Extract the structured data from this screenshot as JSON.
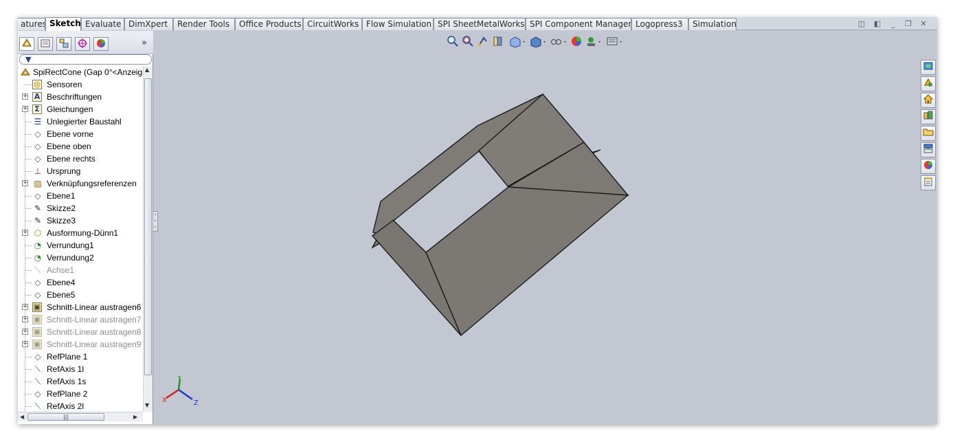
{
  "tabs": [
    {
      "label": "atures",
      "active": false
    },
    {
      "label": "Sketch",
      "active": true
    },
    {
      "label": "Evaluate",
      "active": false
    },
    {
      "label": "DimXpert",
      "active": false
    },
    {
      "label": "Render Tools",
      "active": false
    },
    {
      "label": "Office Products",
      "active": false
    },
    {
      "label": "CircuitWorks",
      "active": false
    },
    {
      "label": "Flow Simulation",
      "active": false
    },
    {
      "label": "SPI SheetMetalWorks",
      "active": false
    },
    {
      "label": "SPI Component Manager",
      "active": false
    },
    {
      "label": "Logopress3",
      "active": false
    },
    {
      "label": "Simulation",
      "active": false
    }
  ],
  "window_controls": {
    "tile_left": "◫",
    "tile_right": "◧",
    "minimize": "_",
    "restore": "❐",
    "close": "✕"
  },
  "panel": {
    "tab_icons": [
      "feature-manager-icon",
      "property-manager-icon",
      "configuration-manager-icon",
      "dimxpert-manager-icon",
      "display-manager-icon"
    ],
    "more": "»",
    "filter_icon": "▼"
  },
  "tree": {
    "root": "SpiRectCone  (Gap 0°<Anzeig",
    "items": [
      {
        "label": "Sensoren",
        "icon": "sensor-icon",
        "glyph": "◎",
        "expandable": false,
        "dim": false
      },
      {
        "label": "Beschriftungen",
        "icon": "annotations-icon",
        "glyph": "A",
        "expandable": true,
        "dim": false
      },
      {
        "label": "Gleichungen",
        "icon": "equations-icon",
        "glyph": "Σ",
        "expandable": true,
        "dim": false
      },
      {
        "label": "Unlegierter Baustahl",
        "icon": "material-icon",
        "glyph": "☰",
        "expandable": false,
        "dim": false
      },
      {
        "label": "Ebene vorne",
        "icon": "plane-icon",
        "glyph": "◇",
        "expandable": false,
        "dim": false
      },
      {
        "label": "Ebene oben",
        "icon": "plane-icon",
        "glyph": "◇",
        "expandable": false,
        "dim": false
      },
      {
        "label": "Ebene rechts",
        "icon": "plane-icon",
        "glyph": "◇",
        "expandable": false,
        "dim": false
      },
      {
        "label": "Ursprung",
        "icon": "origin-icon",
        "glyph": "⊥",
        "expandable": false,
        "dim": false
      },
      {
        "label": "Verknüpfungsreferenzen",
        "icon": "mate-reference-icon",
        "glyph": "▨",
        "expandable": true,
        "dim": false
      },
      {
        "label": "Ebene1",
        "icon": "plane-icon",
        "glyph": "◇",
        "expandable": false,
        "dim": false
      },
      {
        "label": "Skizze2",
        "icon": "sketch-icon",
        "glyph": "✎",
        "expandable": false,
        "dim": false
      },
      {
        "label": "Skizze3",
        "icon": "sketch-icon",
        "glyph": "✎",
        "expandable": false,
        "dim": false
      },
      {
        "label": "Ausformung-Dünn1",
        "icon": "loft-icon",
        "glyph": "⬡",
        "expandable": true,
        "dim": false
      },
      {
        "label": "Verrundung1",
        "icon": "fillet-icon",
        "glyph": "◔",
        "expandable": false,
        "dim": false
      },
      {
        "label": "Verrundung2",
        "icon": "fillet-icon",
        "glyph": "◔",
        "expandable": false,
        "dim": false
      },
      {
        "label": "Achse1",
        "icon": "axis-icon",
        "glyph": "⟍",
        "expandable": false,
        "dim": true
      },
      {
        "label": "Ebene4",
        "icon": "plane-icon",
        "glyph": "◇",
        "expandable": false,
        "dim": false
      },
      {
        "label": "Ebene5",
        "icon": "plane-icon",
        "glyph": "◇",
        "expandable": false,
        "dim": false
      },
      {
        "label": "Schnitt-Linear austragen6",
        "icon": "cut-extrude-icon",
        "glyph": "▣",
        "expandable": true,
        "dim": false
      },
      {
        "label": "Schnitt-Linear austragen7",
        "icon": "cut-extrude-icon",
        "glyph": "▣",
        "expandable": true,
        "dim": true
      },
      {
        "label": "Schnitt-Linear austragen8",
        "icon": "cut-extrude-icon",
        "glyph": "▣",
        "expandable": true,
        "dim": true
      },
      {
        "label": "Schnitt-Linear austragen9",
        "icon": "cut-extrude-icon",
        "glyph": "▣",
        "expandable": true,
        "dim": true
      },
      {
        "label": "RefPlane 1",
        "icon": "plane-icon",
        "glyph": "◇",
        "expandable": false,
        "dim": false
      },
      {
        "label": "RefAxis 1l",
        "icon": "axis-icon",
        "glyph": "⟍",
        "expandable": false,
        "dim": false
      },
      {
        "label": "RefAxis 1s",
        "icon": "axis-icon",
        "glyph": "⟍",
        "expandable": false,
        "dim": false
      },
      {
        "label": "RefPlane 2",
        "icon": "plane-icon",
        "glyph": "◇",
        "expandable": false,
        "dim": false
      },
      {
        "label": "RefAxis 2l",
        "icon": "axis-icon",
        "glyph": "⟍",
        "expandable": false,
        "dim": false
      }
    ]
  },
  "hud": [
    {
      "name": "zoom-to-fit-icon",
      "glyph": "🔍"
    },
    {
      "name": "zoom-to-area-icon",
      "glyph": "🔎"
    },
    {
      "name": "previous-view-icon",
      "glyph": "↶"
    },
    {
      "name": "section-view-icon",
      "glyph": "◨"
    },
    {
      "name": "view-orientation-icon",
      "glyph": "⧉▾"
    },
    {
      "name": "display-style-icon",
      "glyph": "◰▾"
    },
    {
      "name": "hide-show-items-icon",
      "glyph": "☍▾"
    },
    {
      "name": "edit-appearance-icon",
      "glyph": "◕"
    },
    {
      "name": "apply-scene-icon",
      "glyph": "☘▾"
    },
    {
      "name": "view-settings-icon",
      "glyph": "▤▾"
    }
  ],
  "task_pane": [
    {
      "name": "solidworks-resources-icon",
      "glyph": "▦"
    },
    {
      "name": "design-library-icon",
      "glyph": "✿"
    },
    {
      "name": "home-icon",
      "glyph": "⌂"
    },
    {
      "name": "file-explorer-icon",
      "glyph": "▥"
    },
    {
      "name": "folder-icon",
      "glyph": "▭"
    },
    {
      "name": "view-palette-icon",
      "glyph": "▤"
    },
    {
      "name": "appearances-icon",
      "glyph": "◕"
    },
    {
      "name": "custom-properties-icon",
      "glyph": "▧"
    }
  ],
  "triad": {
    "x": "X",
    "y": "Y",
    "z": "Z"
  },
  "colors": {
    "face": "#7f7c78",
    "face_dark": "#757270",
    "edge": "#1a1a1a",
    "background": "#c2c7d2"
  }
}
